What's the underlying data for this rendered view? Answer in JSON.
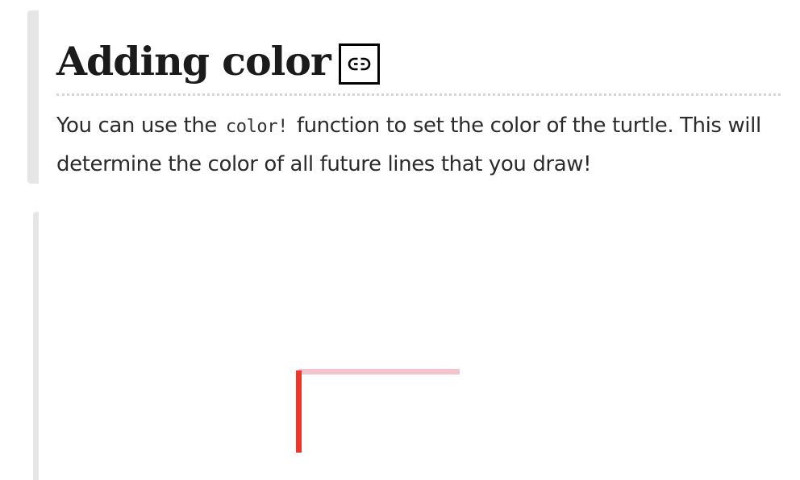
{
  "section": {
    "heading": "Adding color",
    "paragraph_before_code": "You can use the ",
    "code": "color!",
    "paragraph_after_code": " function to set the color of the turtle. This will determine the color of all future lines that you draw!"
  },
  "icons": {
    "anchor": "link-icon"
  },
  "drawing": {
    "lines": [
      {
        "color": "#f4c4cc",
        "description_color": "pink"
      },
      {
        "color": "#ee3528",
        "description_color": "red"
      }
    ]
  }
}
